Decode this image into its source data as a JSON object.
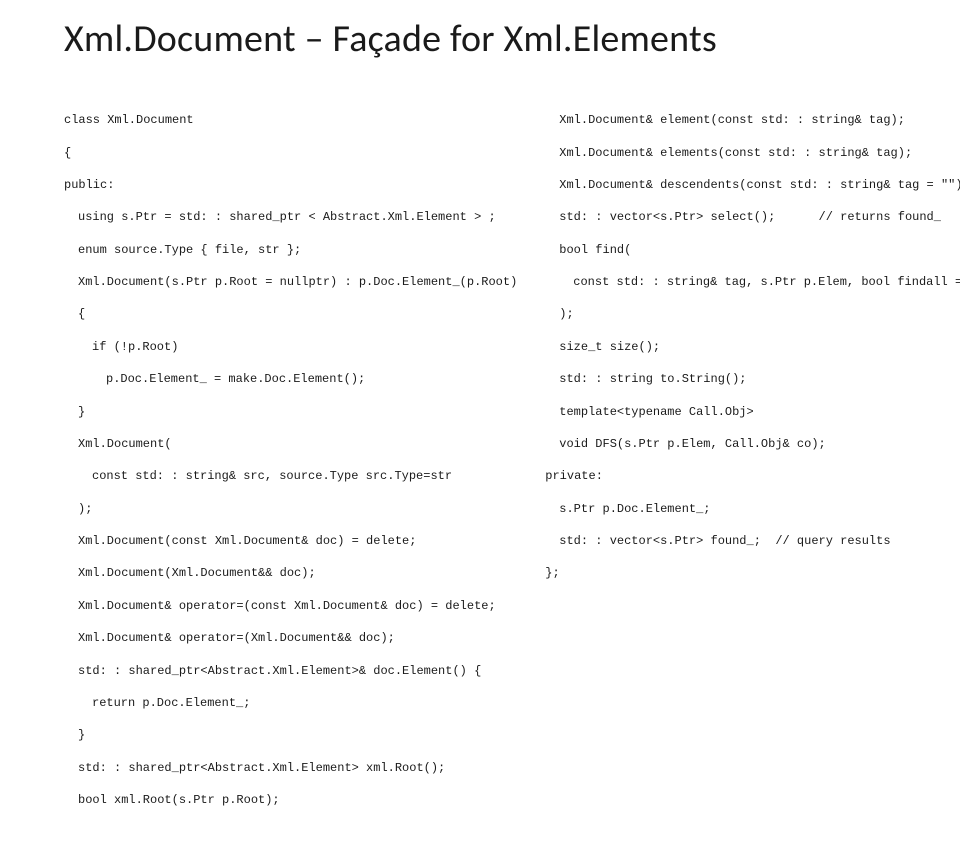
{
  "title": "Xml.Document – Façade for Xml.Elements",
  "left": {
    "l0": "class Xml.Document",
    "l1": "{",
    "l2": "public:",
    "l3": "using s.Ptr = std: : shared_ptr < Abstract.Xml.Element > ;",
    "l4": "enum source.Type { file, str };",
    "l5": "Xml.Document(s.Ptr p.Root = nullptr) : p.Doc.Element_(p.Root)",
    "l6": "{",
    "l7": "if (!p.Root)",
    "l8": "p.Doc.Element_ = make.Doc.Element();",
    "l9": "}",
    "l10": "Xml.Document(",
    "l11": "const std: : string& src, source.Type src.Type=str",
    "l12": ");",
    "l13": "Xml.Document(const Xml.Document& doc) = delete;",
    "l14": "Xml.Document(Xml.Document&& doc);",
    "l15": "Xml.Document& operator=(const Xml.Document& doc) = delete;",
    "l16": "Xml.Document& operator=(Xml.Document&& doc);",
    "l17": "std: : shared_ptr<Abstract.Xml.Element>& doc.Element() {",
    "l18": "return p.Doc.Element_;",
    "l19": "}",
    "l20": "std: : shared_ptr<Abstract.Xml.Element> xml.Root();",
    "l21": "bool xml.Root(s.Ptr p.Root);"
  },
  "right": {
    "r0": "Xml.Document& element(const std: : string& tag);",
    "r1": "Xml.Document& elements(const std: : string& tag);",
    "r2": "Xml.Document& descendents(const std: : string& tag = \"\");",
    "r3": "std: : vector<s.Ptr> select();      // returns found_",
    "r4": "bool find(",
    "r5": "const std: : string& tag, s.Ptr p.Elem, bool findall = true",
    "r6": ");",
    "r7": "size_t size();",
    "r8": "std: : string to.String();",
    "r9": "template<typename Call.Obj>",
    "r10": "void DFS(s.Ptr p.Elem, Call.Obj& co);",
    "r11": "private:",
    "r12": "s.Ptr p.Doc.Element_;",
    "r13": "std: : vector<s.Ptr> found_;  // query results",
    "r14": "};"
  }
}
